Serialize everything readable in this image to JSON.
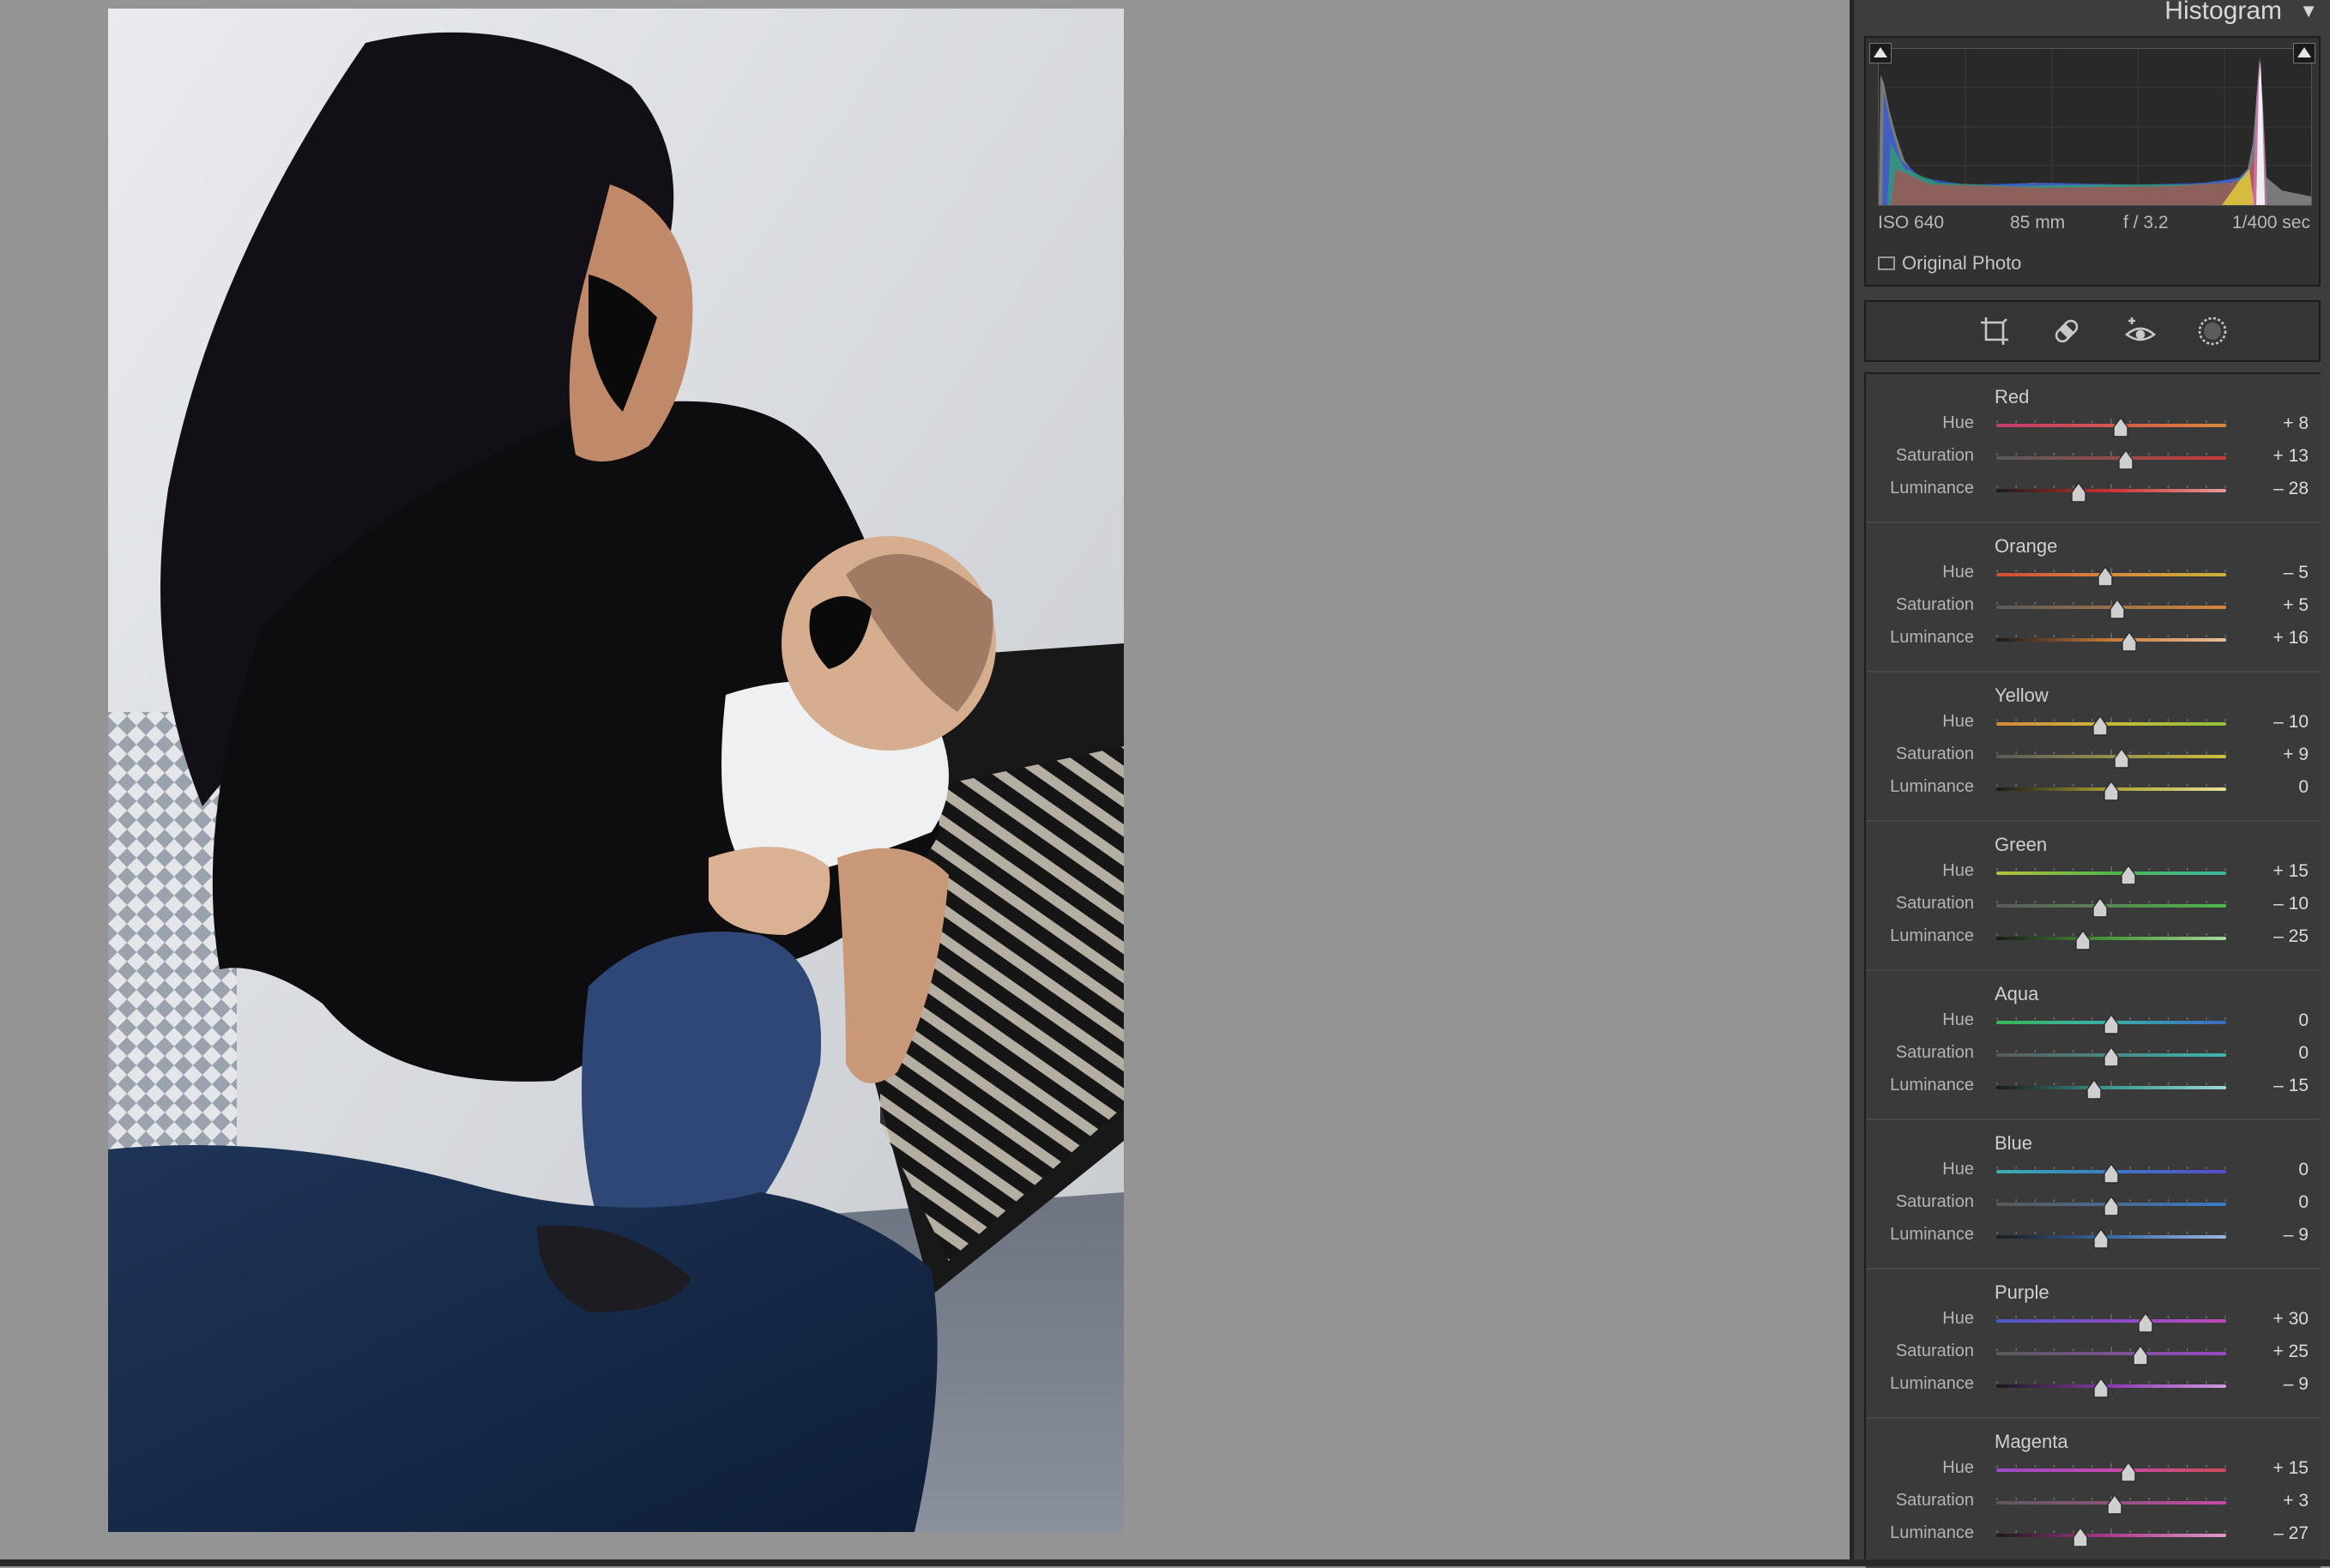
{
  "histogram": {
    "title": "Histogram",
    "exif": {
      "iso": "ISO 640",
      "focal": "85 mm",
      "aperture": "f / 3.2",
      "shutter": "1/400 sec"
    },
    "original_photo_label": "Original Photo"
  },
  "tools": [
    {
      "name": "crop-tool-icon"
    },
    {
      "name": "healing-tool-icon"
    },
    {
      "name": "red-eye-tool-icon"
    },
    {
      "name": "masking-tool-icon"
    }
  ],
  "hsl": {
    "groups": [
      {
        "title": "Red",
        "key": "red",
        "rows": [
          {
            "label": "Hue",
            "value": "+ 8",
            "n": 8,
            "gradient": [
              "#c23b6f",
              "#d9564a",
              "#d98a3a"
            ]
          },
          {
            "label": "Saturation",
            "value": "+ 13",
            "n": 13,
            "gradient": [
              "#5a5a5a",
              "#cc3b3b"
            ]
          },
          {
            "label": "Luminance",
            "value": "– 28",
            "n": -28,
            "gradient": [
              "#1a1a1a",
              "#cc3333",
              "#e79a9a"
            ]
          }
        ]
      },
      {
        "title": "Orange",
        "key": "orange",
        "rows": [
          {
            "label": "Hue",
            "value": "– 5",
            "n": -5,
            "gradient": [
              "#d04a3a",
              "#d98a3a",
              "#c9b33a"
            ]
          },
          {
            "label": "Saturation",
            "value": "+ 5",
            "n": 5,
            "gradient": [
              "#5a5a5a",
              "#d9873a"
            ]
          },
          {
            "label": "Luminance",
            "value": "+ 16",
            "n": 16,
            "gradient": [
              "#1a1a1a",
              "#c97a3a",
              "#e8c09a"
            ]
          }
        ]
      },
      {
        "title": "Yellow",
        "key": "yellow",
        "rows": [
          {
            "label": "Hue",
            "value": "– 10",
            "n": -10,
            "gradient": [
              "#d58a3a",
              "#c9b83a",
              "#8fc03a"
            ]
          },
          {
            "label": "Saturation",
            "value": "+ 9",
            "n": 9,
            "gradient": [
              "#5a5a5a",
              "#cfc23a"
            ]
          },
          {
            "label": "Luminance",
            "value": "0",
            "n": 0,
            "gradient": [
              "#1a1a1a",
              "#a9a230",
              "#e6e29a"
            ]
          }
        ]
      },
      {
        "title": "Green",
        "key": "green",
        "rows": [
          {
            "label": "Hue",
            "value": "+ 15",
            "n": 15,
            "gradient": [
              "#b8c03a",
              "#4fb84a",
              "#3ab8a0"
            ]
          },
          {
            "label": "Saturation",
            "value": "– 10",
            "n": -10,
            "gradient": [
              "#5a5a5a",
              "#4fb84a"
            ]
          },
          {
            "label": "Luminance",
            "value": "– 25",
            "n": -25,
            "gradient": [
              "#1a1a1a",
              "#4a9a3a",
              "#a8d89a"
            ]
          }
        ]
      },
      {
        "title": "Aqua",
        "key": "aqua",
        "rows": [
          {
            "label": "Hue",
            "value": "0",
            "n": 0,
            "gradient": [
              "#3ab85a",
              "#3ab0b0",
              "#3a6ac0"
            ]
          },
          {
            "label": "Saturation",
            "value": "0",
            "n": 0,
            "gradient": [
              "#5a5a5a",
              "#3ab8b0"
            ]
          },
          {
            "label": "Luminance",
            "value": "– 15",
            "n": -15,
            "gradient": [
              "#1a1a1a",
              "#3a9a90",
              "#9ad8d0"
            ]
          }
        ]
      },
      {
        "title": "Blue",
        "key": "blue",
        "rows": [
          {
            "label": "Hue",
            "value": "0",
            "n": 0,
            "gradient": [
              "#3ab0b0",
              "#3a7ac8",
              "#5a4ac8"
            ]
          },
          {
            "label": "Saturation",
            "value": "0",
            "n": 0,
            "gradient": [
              "#5a5a5a",
              "#3a7ac8"
            ]
          },
          {
            "label": "Luminance",
            "value": "– 9",
            "n": -9,
            "gradient": [
              "#1a1a1a",
              "#3a6aa8",
              "#9ab8e0"
            ]
          }
        ]
      },
      {
        "title": "Purple",
        "key": "purple",
        "rows": [
          {
            "label": "Hue",
            "value": "+ 30",
            "n": 30,
            "gradient": [
              "#4a5ac8",
              "#8a4ac8",
              "#c04ab8"
            ]
          },
          {
            "label": "Saturation",
            "value": "+ 25",
            "n": 25,
            "gradient": [
              "#5a5a5a",
              "#9a4ac8"
            ]
          },
          {
            "label": "Luminance",
            "value": "– 9",
            "n": -9,
            "gradient": [
              "#1a1a1a",
              "#8a3ab0",
              "#d09ae0"
            ]
          }
        ]
      },
      {
        "title": "Magenta",
        "key": "magenta",
        "rows": [
          {
            "label": "Hue",
            "value": "+ 15",
            "n": 15,
            "gradient": [
              "#9a4ac8",
              "#c84ab0",
              "#d04a5a"
            ]
          },
          {
            "label": "Saturation",
            "value": "+ 3",
            "n": 3,
            "gradient": [
              "#5a5a5a",
              "#c84aa8"
            ]
          },
          {
            "label": "Luminance",
            "value": "– 27",
            "n": -27,
            "gradient": [
              "#1a1a1a",
              "#b03a90",
              "#e09ac8"
            ]
          }
        ]
      }
    ]
  }
}
